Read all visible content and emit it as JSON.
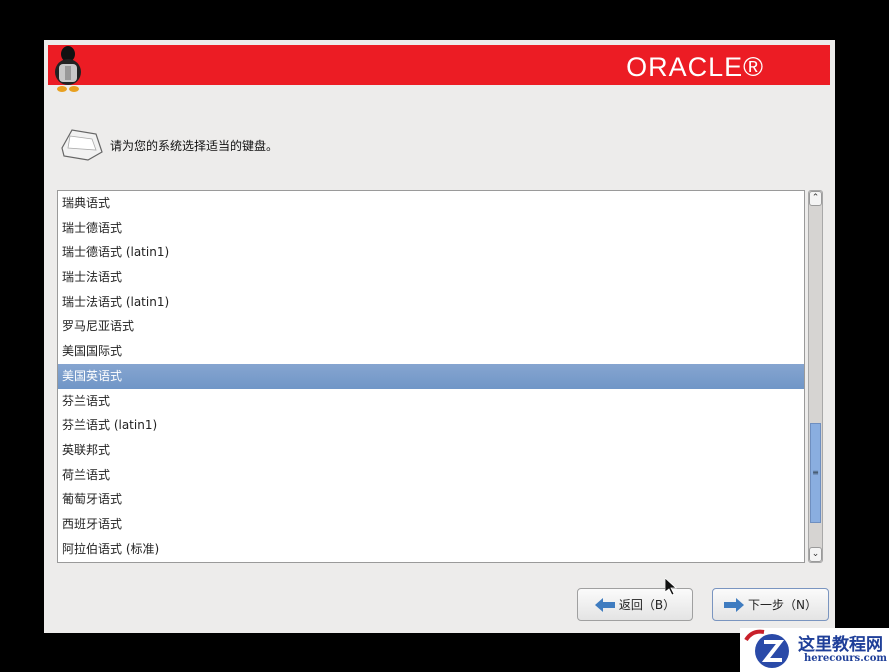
{
  "header": {
    "brand": "ORACLE®",
    "accent": "#ec1c24"
  },
  "prompt": "请为您的系统选择适当的键盘。",
  "keyboards": [
    {
      "label": "瑞典语式"
    },
    {
      "label": "瑞士德语式"
    },
    {
      "label": "瑞士德语式 (latin1)"
    },
    {
      "label": "瑞士法语式"
    },
    {
      "label": "瑞士法语式 (latin1)"
    },
    {
      "label": "罗马尼亚语式"
    },
    {
      "label": "美国国际式"
    },
    {
      "label": "美国英语式",
      "selected": true
    },
    {
      "label": "芬兰语式"
    },
    {
      "label": "芬兰语式 (latin1)"
    },
    {
      "label": "英联邦式"
    },
    {
      "label": "荷兰语式"
    },
    {
      "label": "葡萄牙语式"
    },
    {
      "label": "西班牙语式"
    },
    {
      "label": "阿拉伯语式 (标准)"
    }
  ],
  "scrollbar": {
    "position_percent": 90
  },
  "buttons": {
    "back": "返回（B）",
    "next": "下一步（N）"
  },
  "watermark": {
    "title": "这里教程网",
    "url": "herecours.com"
  }
}
